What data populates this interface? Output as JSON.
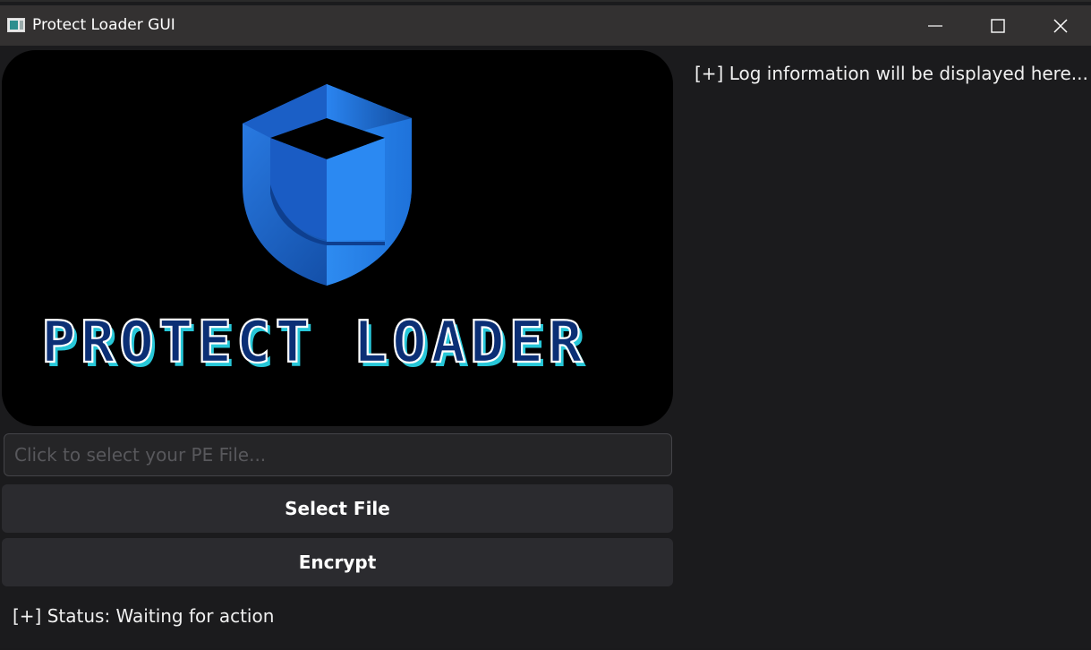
{
  "window": {
    "title": "Protect Loader GUI",
    "controls": {
      "minimize": "minimize-icon",
      "maximize": "maximize-icon",
      "close": "close-icon"
    }
  },
  "logo": {
    "text": "PROTECT LOADER",
    "colors": {
      "shield_light": "#2f8ef4",
      "shield_dark": "#0b3f92",
      "letter_fill": "#0b2f75",
      "letter_outline": "#ffffff",
      "letter_shadow": "#27c7d8"
    }
  },
  "file_picker": {
    "placeholder": "Click to select your PE File...",
    "value": ""
  },
  "buttons": {
    "select_file": "Select File",
    "encrypt": "Encrypt"
  },
  "status": {
    "text": "[+] Status: Waiting for action"
  },
  "log": {
    "text": "[+] Log information will be displayed here..."
  },
  "theme": {
    "background": "#1b1b1d",
    "titlebar": "#333131",
    "button": "#2b2b2f",
    "input": "#252527"
  }
}
